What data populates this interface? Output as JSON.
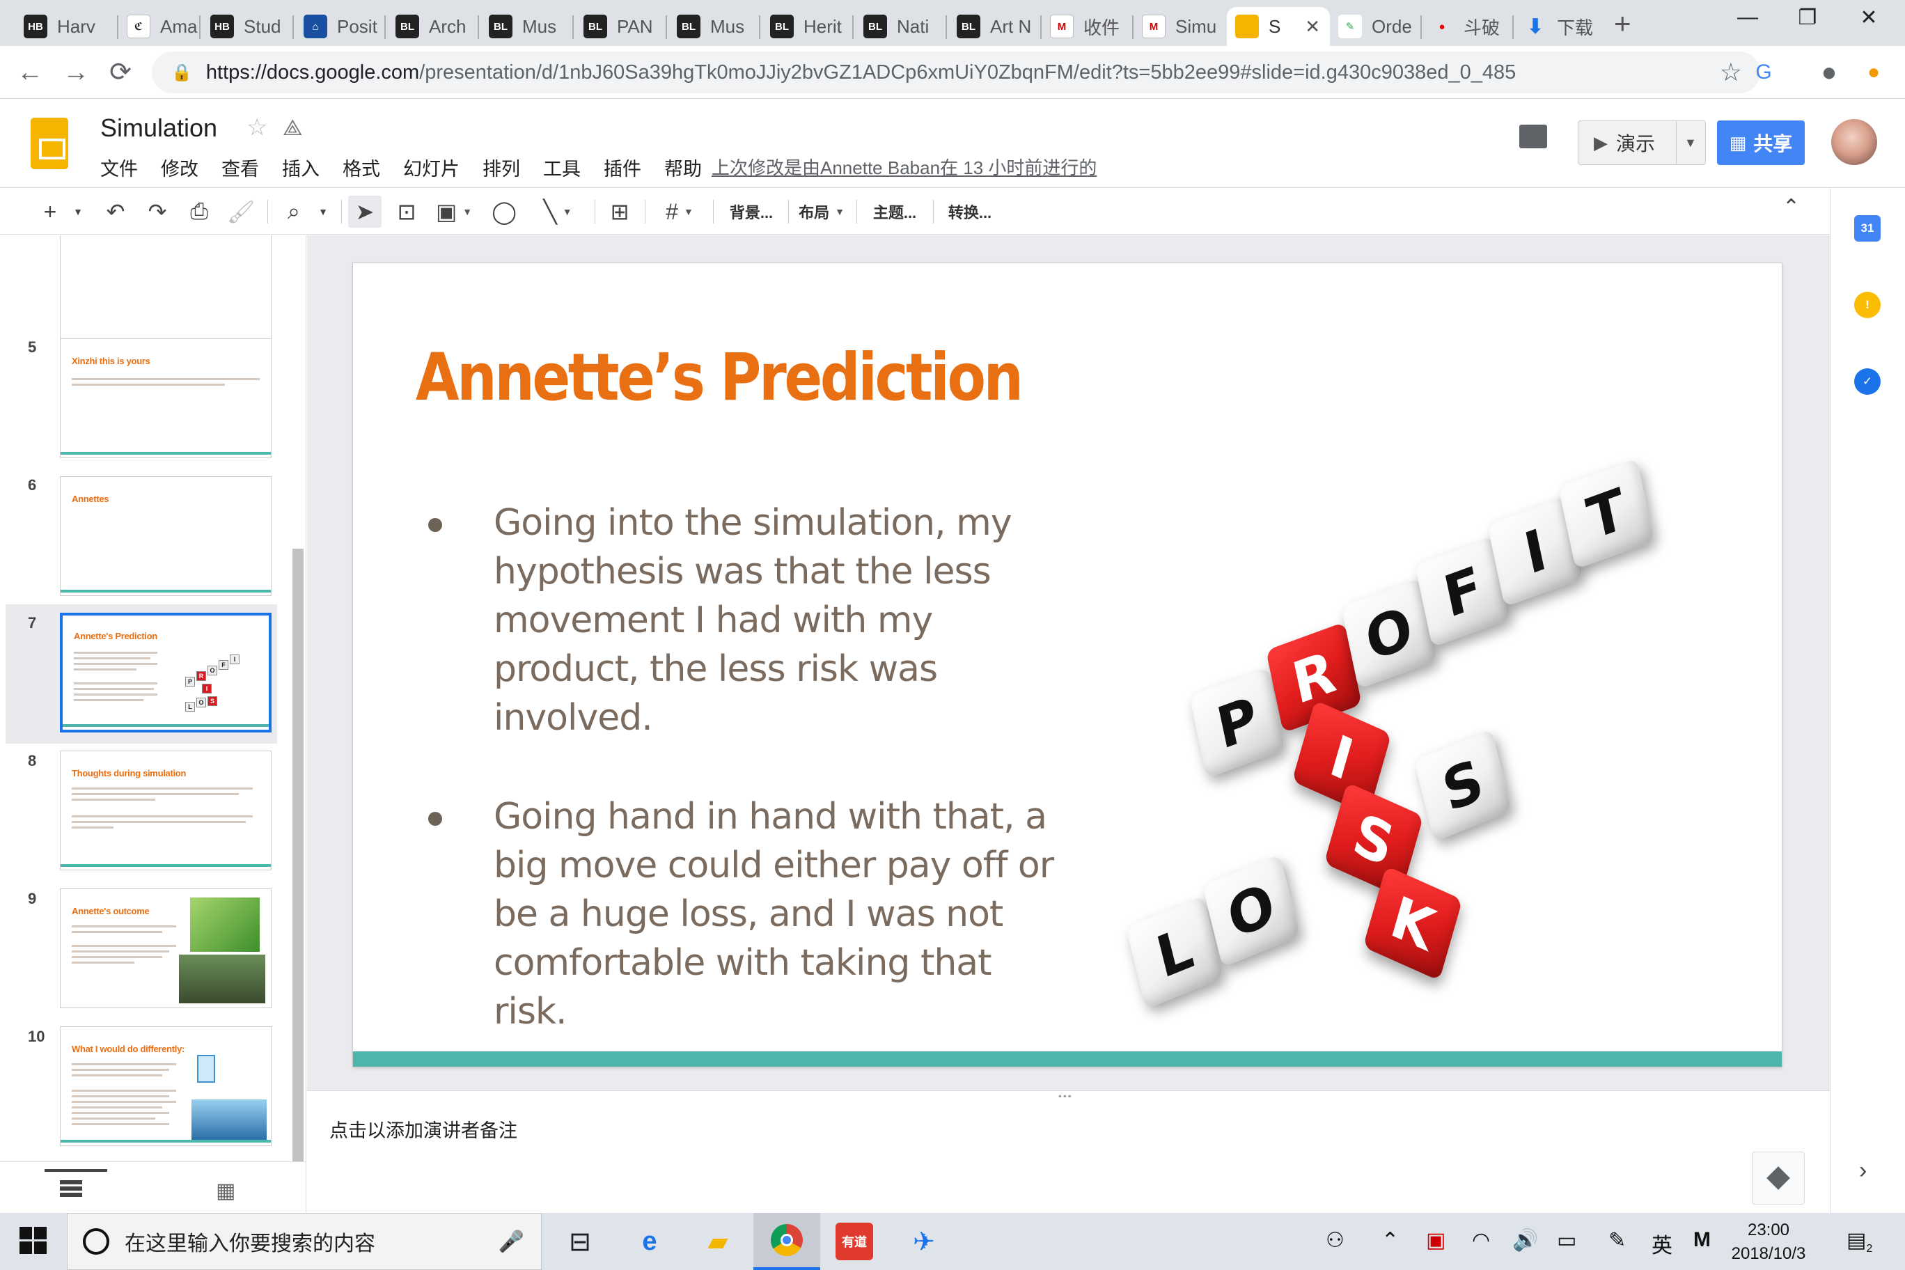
{
  "browser": {
    "tabs": [
      {
        "fav": "HB",
        "label": "Harv"
      },
      {
        "fav": "ℭ",
        "label": "Ama"
      },
      {
        "fav": "HB",
        "label": "Stud"
      },
      {
        "fav": "⌂",
        "label": "Posit"
      },
      {
        "fav": "BL",
        "label": "Arch"
      },
      {
        "fav": "BL",
        "label": "Mus"
      },
      {
        "fav": "BL",
        "label": "PAN"
      },
      {
        "fav": "BL",
        "label": "Mus"
      },
      {
        "fav": "BL",
        "label": "Herit"
      },
      {
        "fav": "BL",
        "label": "Nati"
      },
      {
        "fav": "BL",
        "label": "Art N"
      },
      {
        "fav": "M",
        "label": "收件"
      },
      {
        "fav": "M",
        "label": "Simu"
      },
      {
        "fav": "",
        "label": "S"
      },
      {
        "fav": "✎",
        "label": "Orde"
      },
      {
        "fav": "●",
        "label": "斗破"
      },
      {
        "fav": "⬇",
        "label": "下载"
      }
    ],
    "url_host": "https://docs.google.com",
    "url_path": "/presentation/d/1nbJ60Sa39hgTk0moJJiy2bvGZ1ADCp6xmUiY0ZbqnFM/edit?ts=5bb2ee99#slide=id.g430c9038ed_0_485"
  },
  "doc": {
    "title": "Simulation",
    "menus": [
      "文件",
      "修改",
      "查看",
      "插入",
      "格式",
      "幻灯片",
      "排列",
      "工具",
      "插件",
      "帮助"
    ],
    "last_edit": "上次修改是由Annette Baban在 13 小时前进行的",
    "present_label": "演示",
    "share_label": "共享"
  },
  "toolbar": {
    "background": "背景...",
    "layout": "布局",
    "theme": "主题...",
    "transition": "转换..."
  },
  "filmstrip": {
    "slides": [
      {
        "num": "",
        "title": ""
      },
      {
        "num": "5",
        "title": "Xinzhi this is yours"
      },
      {
        "num": "6",
        "title": "Annettes"
      },
      {
        "num": "7",
        "title": "Annette's Prediction"
      },
      {
        "num": "8",
        "title": "Thoughts during simulation"
      },
      {
        "num": "9",
        "title": "Annette's outcome"
      },
      {
        "num": "10",
        "title": "What I would do differently:"
      }
    ]
  },
  "slide": {
    "title": "Annette’s Prediction",
    "bullets": [
      "Going into the simulation, my hypothesis was that the less movement I had with my product, the less risk was involved.",
      "Going hand in hand with that, a big move could either pay off or be a huge loss, and I was not comfortable with taking that risk."
    ],
    "cubes": {
      "profit": [
        "P",
        "R",
        "O",
        "F",
        "I",
        "T"
      ],
      "risk": [
        "R",
        "I",
        "S",
        "K"
      ],
      "loss": [
        "L",
        "O",
        "S",
        "S"
      ]
    }
  },
  "notes": {
    "placeholder": "点击以添加演讲者备注"
  },
  "taskbar": {
    "search_placeholder": "在这里输入你要搜索的内容",
    "ime": "英",
    "time": "23:00",
    "date": "2018/10/3",
    "notif_count": "2"
  },
  "colors": {
    "title_orange": "#e96f13",
    "accent_teal": "#4db6ac",
    "cube_red": "#e21d1d",
    "share_blue": "#4285f4"
  }
}
